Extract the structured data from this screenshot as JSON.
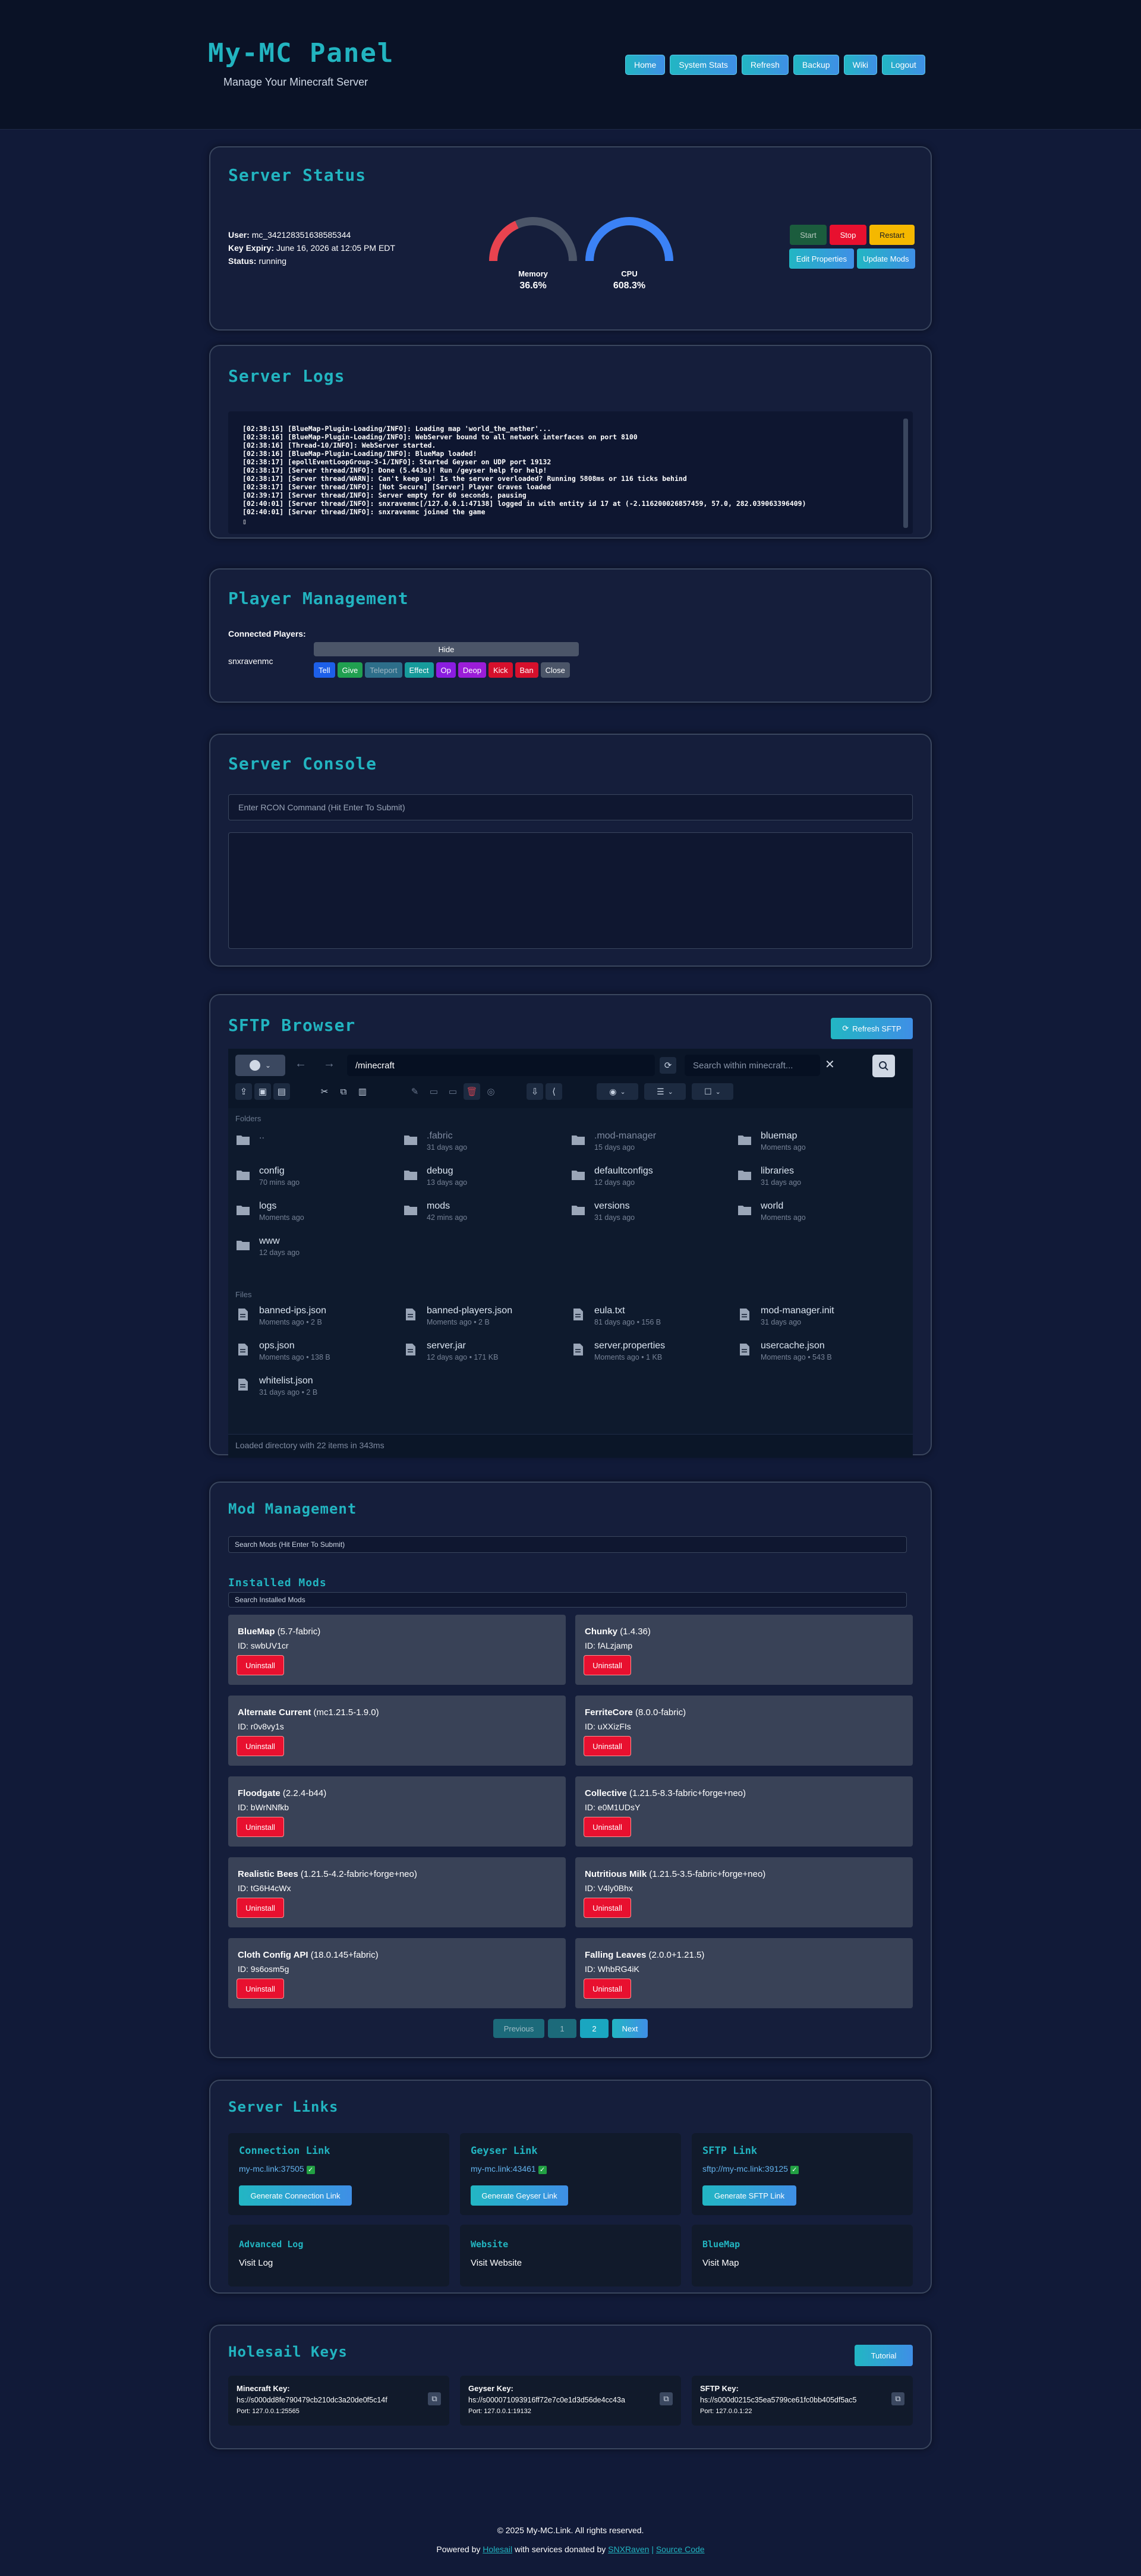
{
  "header": {
    "brand": "My-MC Panel",
    "tagline": "Manage Your Minecraft Server",
    "nav": [
      "Home",
      "System Stats",
      "Refresh",
      "Backup",
      "Wiki",
      "Logout"
    ]
  },
  "status": {
    "title": "Server Status",
    "user_label": "User:",
    "user_value": "mc_342128351638585344",
    "expiry_label": "Key Expiry:",
    "expiry_value": "June 16, 2026 at 12:05 PM EDT",
    "status_label": "Status:",
    "status_value": "running",
    "memory_label": "Memory",
    "memory_value": "36.6%",
    "memory_fraction": 0.366,
    "cpu_label": "CPU",
    "cpu_value": "608.3%",
    "cpu_fraction": 1.0,
    "buttons": {
      "start": "Start",
      "stop": "Stop",
      "restart": "Restart",
      "edit_properties": "Edit Properties",
      "update_mods": "Update Mods"
    }
  },
  "logs": {
    "title": "Server Logs",
    "lines": [
      "[02:38:15] [BlueMap-Plugin-Loading/INFO]: Loading map 'world_the_nether'...",
      "[02:38:16] [BlueMap-Plugin-Loading/INFO]: WebServer bound to all network interfaces on port 8100",
      "[02:38:16] [Thread-10/INFO]: WebServer started.",
      "[02:38:16] [BlueMap-Plugin-Loading/INFO]: BlueMap loaded!",
      "[02:38:17] [epollEventLoopGroup-3-1/INFO]: Started Geyser on UDP port 19132",
      "[02:38:17] [Server thread/INFO]: Done (5.443s)! Run /geyser help for help!",
      "[02:38:17] [Server thread/WARN]: Can't keep up! Is the server overloaded? Running 5808ms or 116 ticks behind",
      "[02:38:17] [Server thread/INFO]: [Not Secure] [Server] Player Graves loaded",
      "[02:39:17] [Server thread/INFO]: Server empty for 60 seconds, pausing",
      "[02:40:01] [Server thread/INFO]: snxravenmc[/127.0.0.1:47138] logged in with entity id 17 at (-2.116200026857459, 57.0, 282.039063396409)",
      "[02:40:01] [Server thread/INFO]: snxravenmc joined the game"
    ]
  },
  "players": {
    "title": "Player Management",
    "connected_label": "Connected Players:",
    "player_name": "snxravenmc",
    "hide_label": "Hide",
    "actions": [
      "Tell",
      "Give",
      "Teleport",
      "Effect",
      "Op",
      "Deop",
      "Kick",
      "Ban",
      "Close"
    ]
  },
  "console": {
    "title": "Server Console",
    "placeholder": "Enter RCON Command (Hit Enter To Submit)"
  },
  "sftp": {
    "title": "SFTP Browser",
    "refresh_label": "Refresh SFTP",
    "path": "/minecraft",
    "search_placeholder": "Search within minecraft...",
    "folders_label": "Folders",
    "files_label": "Files",
    "folders": [
      {
        "name": "..",
        "meta": ""
      },
      {
        "name": ".fabric",
        "meta": "31 days ago"
      },
      {
        "name": ".mod-manager",
        "meta": "15 days ago"
      },
      {
        "name": "bluemap",
        "meta": "Moments ago"
      },
      {
        "name": "config",
        "meta": "70 mins ago"
      },
      {
        "name": "debug",
        "meta": "13 days ago"
      },
      {
        "name": "defaultconfigs",
        "meta": "12 days ago"
      },
      {
        "name": "libraries",
        "meta": "31 days ago"
      },
      {
        "name": "logs",
        "meta": "Moments ago"
      },
      {
        "name": "mods",
        "meta": "42 mins ago"
      },
      {
        "name": "versions",
        "meta": "31 days ago"
      },
      {
        "name": "world",
        "meta": "Moments ago"
      },
      {
        "name": "www",
        "meta": "12 days ago"
      }
    ],
    "files": [
      {
        "name": "banned-ips.json",
        "meta": "Moments ago • 2 B"
      },
      {
        "name": "banned-players.json",
        "meta": "Moments ago • 2 B"
      },
      {
        "name": "eula.txt",
        "meta": "81 days ago • 156 B"
      },
      {
        "name": "mod-manager.init",
        "meta": "31 days ago"
      },
      {
        "name": "ops.json",
        "meta": "Moments ago • 138 B"
      },
      {
        "name": "server.jar",
        "meta": "12 days ago • 171 KB"
      },
      {
        "name": "server.properties",
        "meta": "Moments ago • 1 KB"
      },
      {
        "name": "usercache.json",
        "meta": "Moments ago • 543 B"
      },
      {
        "name": "whitelist.json",
        "meta": "31 days ago • 2 B"
      }
    ],
    "status_text": "Loaded directory with 22 items in 343ms"
  },
  "mods": {
    "title": "Mod Management",
    "search_mods_placeholder": "Search Mods (Hit Enter To Submit)",
    "installed_title": "Installed Mods",
    "search_installed_placeholder": "Search Installed Mods",
    "id_prefix": "ID:",
    "uninstall_label": "Uninstall",
    "items": [
      {
        "name": "BlueMap",
        "version": "(5.7-fabric)",
        "id": "swbUV1cr"
      },
      {
        "name": "Chunky",
        "version": "(1.4.36)",
        "id": "fALzjamp"
      },
      {
        "name": "Alternate Current",
        "version": "(mc1.21.5-1.9.0)",
        "id": "r0v8vy1s"
      },
      {
        "name": "FerriteCore",
        "version": "(8.0.0-fabric)",
        "id": "uXXizFIs"
      },
      {
        "name": "Floodgate",
        "version": "(2.2.4-b44)",
        "id": "bWrNNfkb"
      },
      {
        "name": "Collective",
        "version": "(1.21.5-8.3-fabric+forge+neo)",
        "id": "e0M1UDsY"
      },
      {
        "name": "Realistic Bees",
        "version": "(1.21.5-4.2-fabric+forge+neo)",
        "id": "tG6H4cWx"
      },
      {
        "name": "Nutritious Milk",
        "version": "(1.21.5-3.5-fabric+forge+neo)",
        "id": "V4ly0Bhx"
      },
      {
        "name": "Cloth Config API",
        "version": "(18.0.145+fabric)",
        "id": "9s6osm5g"
      },
      {
        "name": "Falling Leaves",
        "version": "(2.0.0+1.21.5)",
        "id": "WhbRG4iK"
      }
    ],
    "pagination": {
      "previous": "Previous",
      "page1": "1",
      "page2": "2",
      "next": "Next"
    }
  },
  "links": {
    "title": "Server Links",
    "connection": {
      "title": "Connection Link",
      "url": "my-mc.link:37505",
      "button": "Generate Connection Link"
    },
    "geyser": {
      "title": "Geyser Link",
      "url": "my-mc.link:43461",
      "button": "Generate Geyser Link"
    },
    "sftp": {
      "title": "SFTP Link",
      "url": "sftp://my-mc.link:39125",
      "button": "Generate SFTP Link"
    },
    "advanced_log": {
      "title": "Advanced Log",
      "link": "Visit Log"
    },
    "website": {
      "title": "Website",
      "link": "Visit Website"
    },
    "bluemap": {
      "title": "BlueMap",
      "link": "Visit Map"
    }
  },
  "keys": {
    "title": "Holesail Keys",
    "tutorial": "Tutorial",
    "minecraft": {
      "label": "Minecraft Key:",
      "value": "hs://s000dd8fe790479cb210dc3a20de0f5c14f",
      "port": "Port: 127.0.0.1:25565"
    },
    "geyser": {
      "label": "Geyser Key:",
      "value": "hs://s000071093916ff72e7c0e1d3d56de4cc43a",
      "port": "Port: 127.0.0.1:19132"
    },
    "sftp": {
      "label": "SFTP Key:",
      "value": "hs://s000d0215c35ea5799ce61fc0bb405df5ac5",
      "port": "Port: 127.0.0.1:22"
    }
  },
  "footer": {
    "copyright": "© 2025 My-MC.Link. All rights reserved.",
    "powered_prefix": "Powered by",
    "holesail": "Holesail",
    "middle": "with services donated by",
    "snxraven": "SNXRaven",
    "sep": "|",
    "source": "Source Code"
  },
  "colors": {
    "accent": "#22b4c0",
    "background": "#111a38",
    "panel": "#151e3b",
    "danger": "#e8102f"
  }
}
